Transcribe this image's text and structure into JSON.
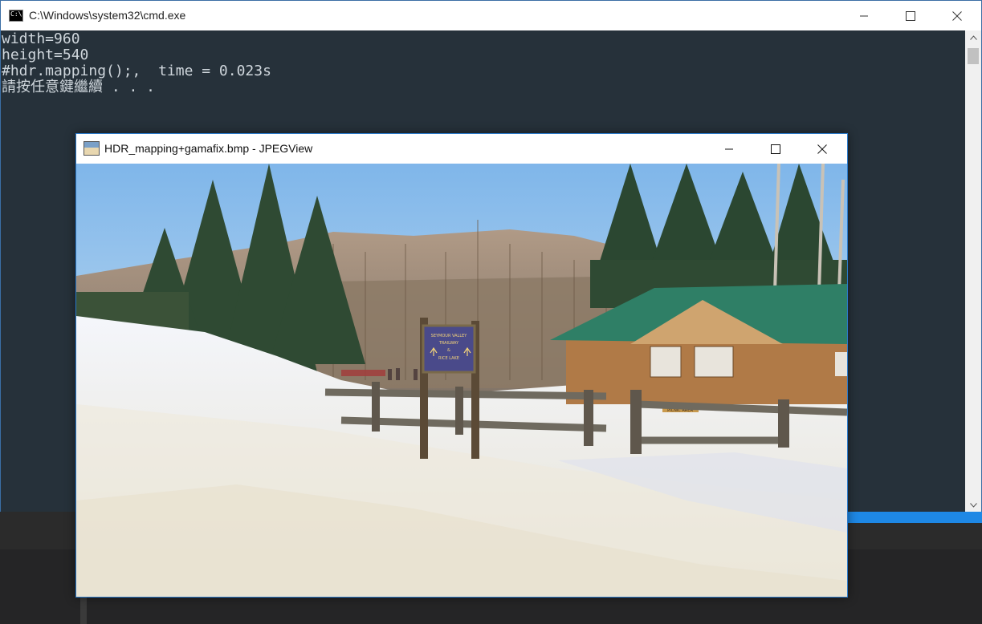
{
  "cmd": {
    "title": "C:\\Windows\\system32\\cmd.exe",
    "icon_label": "C:\\.",
    "lines": [
      "width=960",
      "height=540",
      "#hdr.mapping();,  time = 0.023s",
      "請按任意鍵繼續 . . ."
    ]
  },
  "viewer": {
    "title": "HDR_mapping+gamafix.bmp - JPEGView",
    "image": {
      "sign_line1": "SEYMOUR VALLEY",
      "sign_line2": "TRAILWAY",
      "sign_line3": "&",
      "sign_line4": "RICE LAKE",
      "cabin_sign": "PICNIC AREA"
    }
  },
  "colors": {
    "cmd_bg": "#26313a",
    "cmd_text": "#cfd6dc",
    "accent_blue": "#1e88e5",
    "roof_green": "#2f7f66"
  },
  "icons": [
    "cmd-app-icon",
    "minimize-icon",
    "maximize-icon",
    "close-icon",
    "scroll-up-icon",
    "scroll-down-icon",
    "image-app-icon"
  ]
}
